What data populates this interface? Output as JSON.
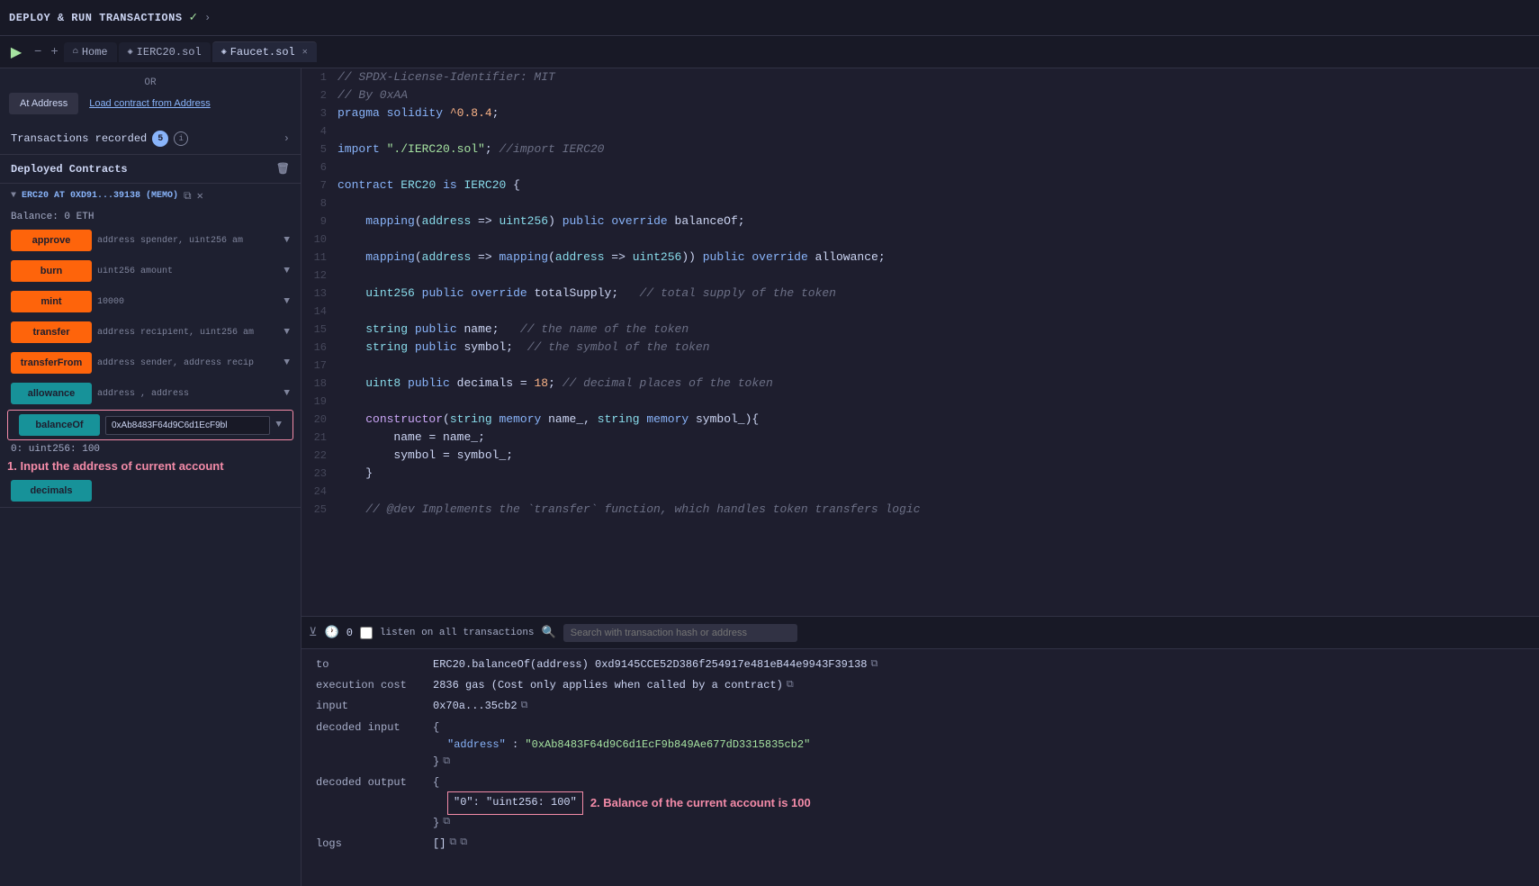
{
  "topbar": {
    "title": "DEPLOY & RUN TRANSACTIONS",
    "check": "✓",
    "arrow": "›"
  },
  "tabs": [
    {
      "id": "run-btn",
      "icon": "▶",
      "type": "run"
    },
    {
      "id": "zoom-out",
      "icon": "−",
      "type": "zoom"
    },
    {
      "id": "zoom-in",
      "icon": "+",
      "type": "zoom"
    },
    {
      "label": "Home",
      "icon": "⌂",
      "active": false
    },
    {
      "label": "IERC20.sol",
      "icon": "◈",
      "active": false
    },
    {
      "label": "Faucet.sol",
      "icon": "◈",
      "active": true,
      "closable": true
    }
  ],
  "sidebar": {
    "or_label": "OR",
    "at_address_btn": "At Address",
    "load_contract_btn": "Load contract from Address",
    "tx_recorded_label": "Transactions recorded",
    "tx_count": "5",
    "tx_arrow": "›",
    "deployed_label": "Deployed Contracts",
    "contract_name": "ERC20 AT 0XD91...39138 (MEMO)",
    "balance_label": "Balance: 0 ETH",
    "functions": [
      {
        "name": "approve",
        "param": "address spender, uint256 am",
        "type": "orange"
      },
      {
        "name": "burn",
        "param": "uint256 amount",
        "type": "orange"
      },
      {
        "name": "mint",
        "param": "10000",
        "type": "orange"
      },
      {
        "name": "transfer",
        "param": "address recipient, uint256 am",
        "type": "orange"
      },
      {
        "name": "transferFrom",
        "param": "address sender, address recip",
        "type": "orange"
      },
      {
        "name": "allowance",
        "param": "address , address",
        "type": "teal"
      },
      {
        "name": "balanceOf",
        "param": "0xAb8483F64d9C6d1EcF9b...",
        "type": "teal"
      },
      {
        "name": "decimals",
        "param": "",
        "type": "teal"
      }
    ],
    "balanceof_value": "0xAb8483F64d9C6d1EcF9bl",
    "result": "0: uint256: 100",
    "annotation1": "1. Input the address of current account"
  },
  "code": {
    "lines": [
      {
        "num": 1,
        "text": "// SPDX-License-Identifier: MIT"
      },
      {
        "num": 2,
        "text": "// By 0xAA"
      },
      {
        "num": 3,
        "text": "pragma solidity ^0.8.4;"
      },
      {
        "num": 4,
        "text": ""
      },
      {
        "num": 5,
        "text": "import \"./IERC20.sol\"; //import IERC20"
      },
      {
        "num": 6,
        "text": ""
      },
      {
        "num": 7,
        "text": "contract ERC20 is IERC20 {"
      },
      {
        "num": 8,
        "text": ""
      },
      {
        "num": 9,
        "text": "    mapping(address => uint256) public override balanceOf;"
      },
      {
        "num": 10,
        "text": ""
      },
      {
        "num": 11,
        "text": "    mapping(address => mapping(address => uint256)) public override allowance;"
      },
      {
        "num": 12,
        "text": ""
      },
      {
        "num": 13,
        "text": "    uint256 public override totalSupply;   // total supply of the token"
      },
      {
        "num": 14,
        "text": ""
      },
      {
        "num": 15,
        "text": "    string public name;   // the name of the token"
      },
      {
        "num": 16,
        "text": "    string public symbol;  // the symbol of the token"
      },
      {
        "num": 17,
        "text": ""
      },
      {
        "num": 18,
        "text": "    uint8 public decimals = 18; // decimal places of the token"
      },
      {
        "num": 19,
        "text": ""
      },
      {
        "num": 20,
        "text": "    constructor(string memory name_, string memory symbol_){"
      },
      {
        "num": 21,
        "text": "        name = name_;"
      },
      {
        "num": 22,
        "text": "        symbol = symbol_;"
      },
      {
        "num": 23,
        "text": "    }"
      },
      {
        "num": 24,
        "text": ""
      },
      {
        "num": 25,
        "text": "    // @dev Implements the `transfer` function, which handles token transfers logic"
      }
    ]
  },
  "bottom": {
    "count": "0",
    "listen_label": "listen on all transactions",
    "search_placeholder": "Search with transaction hash or address",
    "fields": [
      {
        "label": "to",
        "value": "ERC20.balanceOf(address) 0xd9145CCE52D386f254917e481eB44e9943F39138",
        "copyable": true
      },
      {
        "label": "execution cost",
        "value": "2836 gas (Cost only applies when called by a contract)",
        "copyable": true
      },
      {
        "label": "input",
        "value": "0x70a...35cb2",
        "copyable": true
      },
      {
        "label": "decoded input",
        "value": "",
        "block": {
          "open": "{",
          "entries": [
            {
              "key": "\"address\"",
              "sep": ":",
              "val": "\"0xAb8483F64d9C6d1EcF9b849Ae677dD3315835cb2\""
            }
          ],
          "close": "}"
        }
      },
      {
        "label": "decoded output",
        "value": "",
        "block": {
          "open": "{",
          "entries": [
            {
              "key": "\"0\"",
              "sep": ":",
              "val": "\"uint256: 100\"",
              "highlighted": true
            }
          ],
          "close": "}"
        }
      }
    ],
    "logs_label": "logs",
    "annotation2": "2. Balance of the current account is 100"
  }
}
